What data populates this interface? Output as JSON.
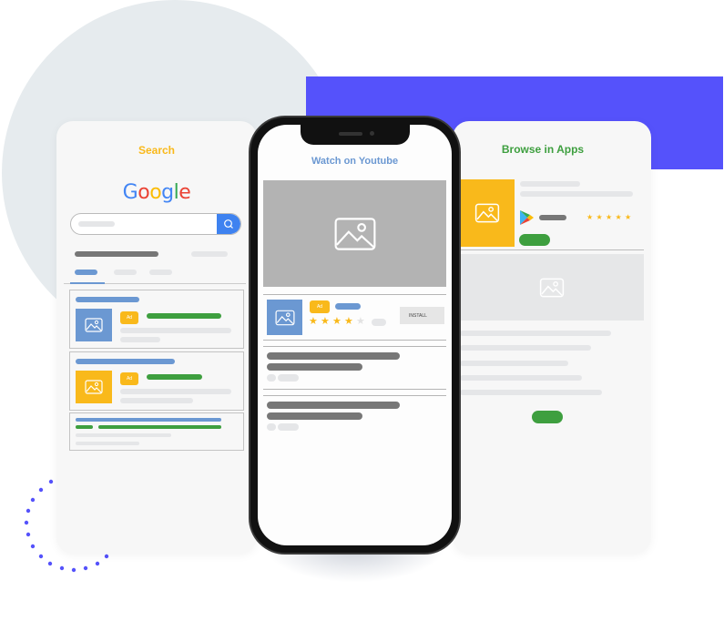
{
  "colors": {
    "accent_blue": "#5552fb",
    "search_title": "#f9b91b",
    "youtube_title": "#6b98d2",
    "apps_title": "#3e9f3f",
    "ad_yellow": "#f9b91b",
    "link_blue": "#6b98d2",
    "url_green": "#3e9f3f",
    "search_button": "#3e82f0"
  },
  "search_card": {
    "title": "Search",
    "logo_letters": [
      {
        "char": "G",
        "color": "#4285f4"
      },
      {
        "char": "o",
        "color": "#ea4335"
      },
      {
        "char": "o",
        "color": "#fbbc05"
      },
      {
        "char": "g",
        "color": "#4285f4"
      },
      {
        "char": "l",
        "color": "#34a853"
      },
      {
        "char": "e",
        "color": "#ea4335"
      }
    ],
    "search_icon": "magnifier-icon",
    "results": [
      {
        "ad_label": "Ad",
        "thumb_color": "#6b98d2",
        "icon": "image-icon"
      },
      {
        "ad_label": "Ad",
        "thumb_color": "#f9b91b",
        "icon": "image-icon"
      }
    ]
  },
  "youtube_card": {
    "title": "Watch on Youtube",
    "video_icon": "image-icon",
    "app_ad_label": "Ad",
    "install_label": "INSTALL",
    "rating": {
      "value": 4,
      "max": 5
    }
  },
  "apps_card": {
    "title": "Browse in Apps",
    "store_icon": "play-store-icon",
    "rating": {
      "value": 5,
      "max": 5
    },
    "image_icon": "image-icon"
  }
}
